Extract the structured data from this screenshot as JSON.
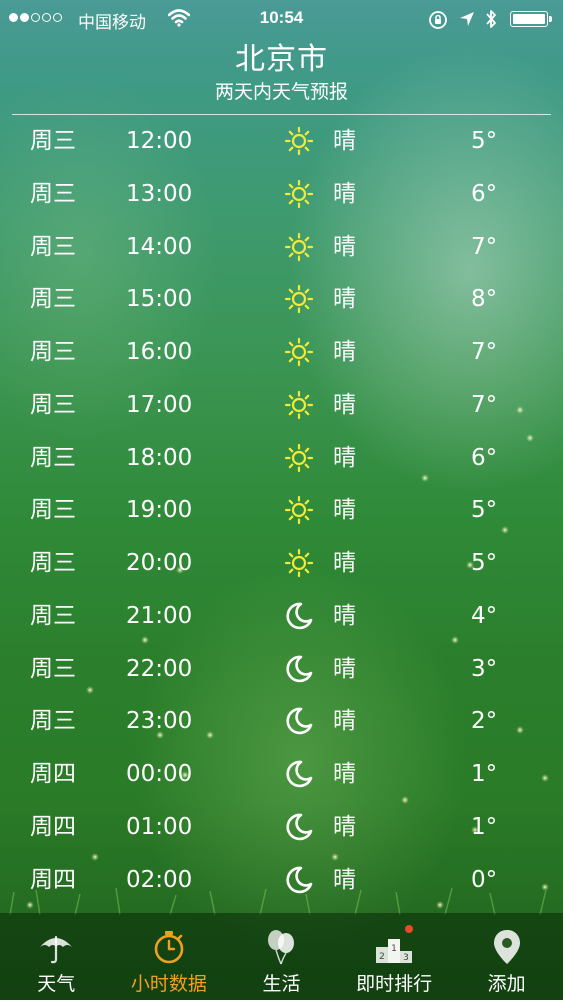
{
  "status_bar": {
    "carrier": "中国移动",
    "time": "10:54",
    "signal_bars_filled": 2,
    "signal_bars_total": 5,
    "battery_level": 1.0
  },
  "header": {
    "city": "北京市",
    "subtitle": "两天内天气预报"
  },
  "forecast": [
    {
      "day": "周三",
      "time": "12:00",
      "icon": "sun-icon",
      "condition": "晴",
      "temp": "5°"
    },
    {
      "day": "周三",
      "time": "13:00",
      "icon": "sun-icon",
      "condition": "晴",
      "temp": "6°"
    },
    {
      "day": "周三",
      "time": "14:00",
      "icon": "sun-icon",
      "condition": "晴",
      "temp": "7°"
    },
    {
      "day": "周三",
      "time": "15:00",
      "icon": "sun-icon",
      "condition": "晴",
      "temp": "8°"
    },
    {
      "day": "周三",
      "time": "16:00",
      "icon": "sun-icon",
      "condition": "晴",
      "temp": "7°"
    },
    {
      "day": "周三",
      "time": "17:00",
      "icon": "sun-icon",
      "condition": "晴",
      "temp": "7°"
    },
    {
      "day": "周三",
      "time": "18:00",
      "icon": "sun-icon",
      "condition": "晴",
      "temp": "6°"
    },
    {
      "day": "周三",
      "time": "19:00",
      "icon": "sun-icon",
      "condition": "晴",
      "temp": "5°"
    },
    {
      "day": "周三",
      "time": "20:00",
      "icon": "sun-icon",
      "condition": "晴",
      "temp": "5°"
    },
    {
      "day": "周三",
      "time": "21:00",
      "icon": "moon-icon",
      "condition": "晴",
      "temp": "4°"
    },
    {
      "day": "周三",
      "time": "22:00",
      "icon": "moon-icon",
      "condition": "晴",
      "temp": "3°"
    },
    {
      "day": "周三",
      "time": "23:00",
      "icon": "moon-icon",
      "condition": "晴",
      "temp": "2°"
    },
    {
      "day": "周四",
      "time": "00:00",
      "icon": "moon-icon",
      "condition": "晴",
      "temp": "1°"
    },
    {
      "day": "周四",
      "time": "01:00",
      "icon": "moon-icon",
      "condition": "晴",
      "temp": "1°"
    },
    {
      "day": "周四",
      "time": "02:00",
      "icon": "moon-icon",
      "condition": "晴",
      "temp": "0°"
    }
  ],
  "tabs": [
    {
      "label": "天气",
      "icon": "umbrella-icon",
      "active": false
    },
    {
      "label": "小时数据",
      "icon": "stopwatch-icon",
      "active": true
    },
    {
      "label": "生活",
      "icon": "balloons-icon",
      "active": false
    },
    {
      "label": "即时排行",
      "icon": "podium-icon",
      "active": false,
      "badge": true
    },
    {
      "label": "添加",
      "icon": "map-pin-icon",
      "active": false
    }
  ],
  "colors": {
    "active_tab": "#f0a020",
    "sun_icon": "#f2ea3a",
    "badge": "#e84a2a"
  }
}
